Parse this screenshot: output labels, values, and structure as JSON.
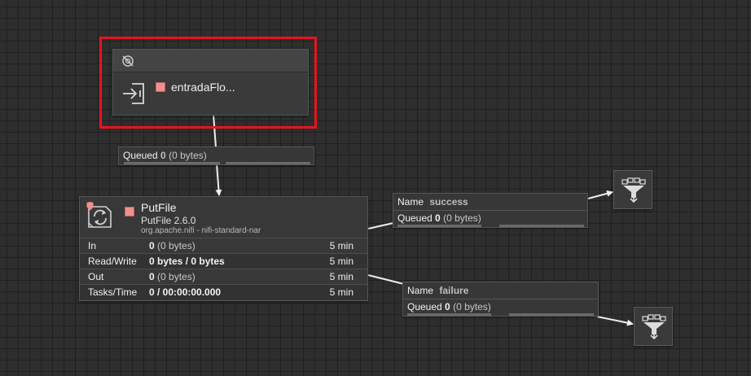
{
  "input_port": {
    "name": "entradaFlo...",
    "status": "stopped",
    "icons": {
      "run": "transmission-disabled-icon",
      "type": "input-port-icon"
    }
  },
  "queue_top": {
    "label": "Queued",
    "count": "0",
    "size": "(0 bytes)"
  },
  "processor": {
    "name": "PutFile",
    "type": "PutFile 2.6.0",
    "bundle": "org.apache.nifi - nifi-standard-nar",
    "status": "stopped",
    "stats": [
      {
        "label": "In",
        "value_bold": "0",
        "value_rest": "(0 bytes)",
        "time": "5 min"
      },
      {
        "label": "Read/Write",
        "value_bold": "0 bytes / 0 bytes",
        "value_rest": "",
        "time": "5 min"
      },
      {
        "label": "Out",
        "value_bold": "0",
        "value_rest": "(0 bytes)",
        "time": "5 min"
      },
      {
        "label": "Tasks/Time",
        "value_bold": "0 / 00:00:00.000",
        "value_rest": "",
        "time": "5 min"
      }
    ]
  },
  "conn_success": {
    "name_label": "Name",
    "name": "success",
    "queued_label": "Queued",
    "count": "0",
    "size": "(0 bytes)"
  },
  "conn_failure": {
    "name_label": "Name",
    "name": "failure",
    "queued_label": "Queued",
    "count": "0",
    "size": "(0 bytes)"
  },
  "funnels": [
    {
      "icon": "funnel-icon"
    },
    {
      "icon": "funnel-icon"
    }
  ],
  "colors": {
    "canvas": "#2e2e2e",
    "grid": "#202020",
    "stopped": "#f0908e",
    "highlight": "#e8141d"
  }
}
